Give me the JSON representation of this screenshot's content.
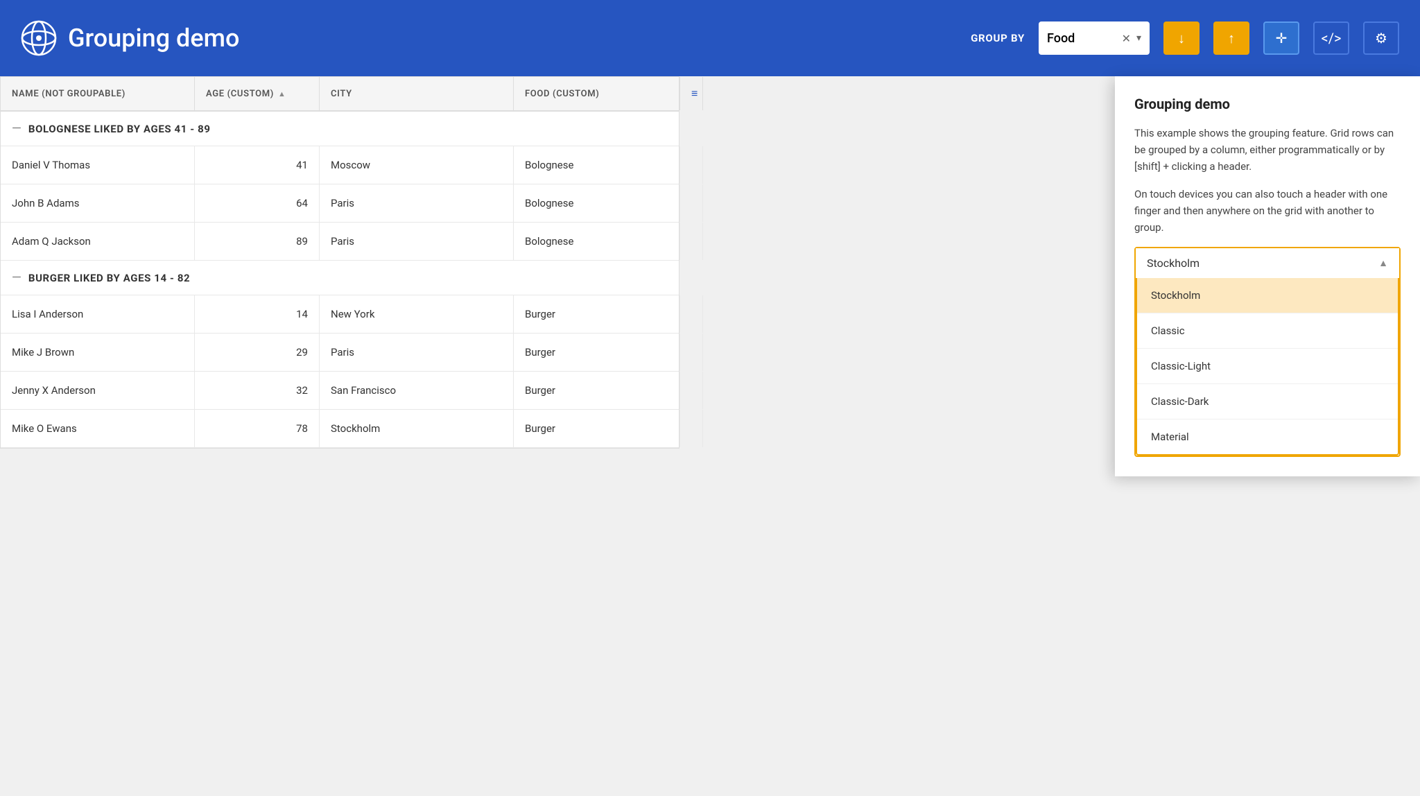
{
  "header": {
    "title": "Grouping demo",
    "group_by_label": "GROUP BY",
    "group_by_value": "Food",
    "buttons": {
      "expand_all": "⬇",
      "collapse_all": "⬆",
      "move": "✛",
      "code": "</>",
      "settings": "⚙"
    }
  },
  "grid": {
    "columns": [
      {
        "label": "NAME (NOT GROUPABLE)",
        "sort": null
      },
      {
        "label": "AGE (CUSTOM)",
        "sort": "asc"
      },
      {
        "label": "CITY",
        "sort": null
      },
      {
        "label": "FOOD (CUSTOM)",
        "sort": null
      },
      {
        "label": "",
        "icon": "list"
      }
    ],
    "groups": [
      {
        "name": "BOLOGNESE LIKED BY AGES 41 - 89",
        "rows": [
          {
            "name": "Daniel V Thomas",
            "age": "41",
            "city": "Moscow",
            "food": "Bolognese"
          },
          {
            "name": "John B Adams",
            "age": "64",
            "city": "Paris",
            "food": "Bolognese"
          },
          {
            "name": "Adam Q Jackson",
            "age": "89",
            "city": "Paris",
            "food": "Bolognese"
          }
        ]
      },
      {
        "name": "BURGER LIKED BY AGES 14 - 82",
        "rows": [
          {
            "name": "Lisa I Anderson",
            "age": "14",
            "city": "New York",
            "food": "Burger"
          },
          {
            "name": "Mike J Brown",
            "age": "29",
            "city": "Paris",
            "food": "Burger"
          },
          {
            "name": "Jenny X Anderson",
            "age": "32",
            "city": "San Francisco",
            "food": "Burger"
          },
          {
            "name": "Mike O Ewans",
            "age": "78",
            "city": "Stockholm",
            "food": "Burger"
          }
        ]
      }
    ]
  },
  "panel": {
    "title": "Grouping demo",
    "desc1": "This example shows the grouping feature. Grid rows can be grouped by a column, either programmatically or by [shift] + clicking a header.",
    "desc2": "On touch devices you can also touch a header with one finger and then anywhere on the grid with another to group.",
    "theme_selector": {
      "current": "Stockholm",
      "options": [
        {
          "label": "Stockholm",
          "selected": true
        },
        {
          "label": "Classic",
          "selected": false
        },
        {
          "label": "Classic-Light",
          "selected": false
        },
        {
          "label": "Classic-Dark",
          "selected": false
        },
        {
          "label": "Material",
          "selected": false
        }
      ]
    }
  }
}
